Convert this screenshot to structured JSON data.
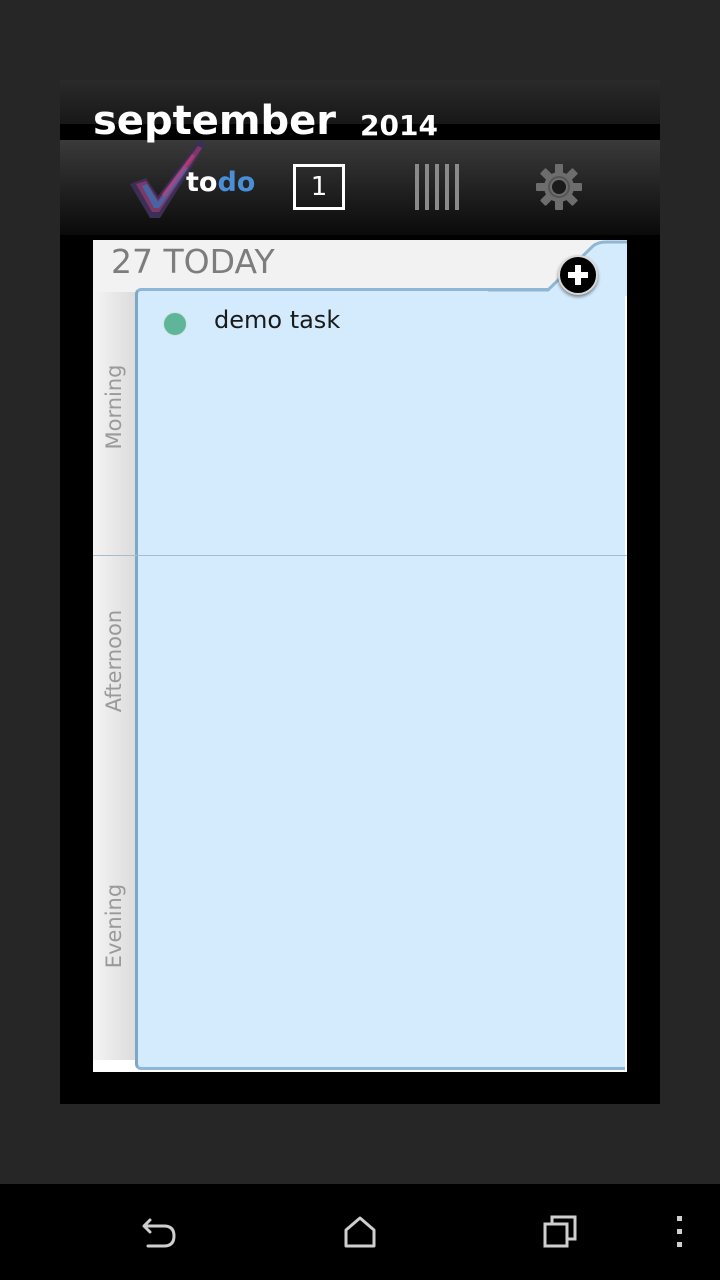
{
  "widget": {
    "month": "september",
    "year": "2014",
    "logo": {
      "text_to": "to",
      "text_do": "do",
      "icon": "checkmark-wordcloud-icon"
    },
    "toolbar": {
      "day_view_label": "1",
      "day_view_icon": "day-view-icon",
      "week_view_icon": "week-view-icon",
      "settings_icon": "gear-icon"
    }
  },
  "planner": {
    "date_label": "27 TODAY",
    "add_icon": "plus-circle-icon",
    "periods": [
      "Morning",
      "Afternoon",
      "Evening"
    ],
    "tasks": [
      {
        "title": "demo task",
        "status_color": "#5fb59a"
      }
    ]
  },
  "navbar": {
    "buttons": [
      "back-icon",
      "home-icon",
      "recents-icon",
      "overflow-menu-icon"
    ]
  },
  "colors": {
    "background": "#262626",
    "slot_background": "#d3ebfd",
    "accent_blue": "#4a8ed8"
  }
}
